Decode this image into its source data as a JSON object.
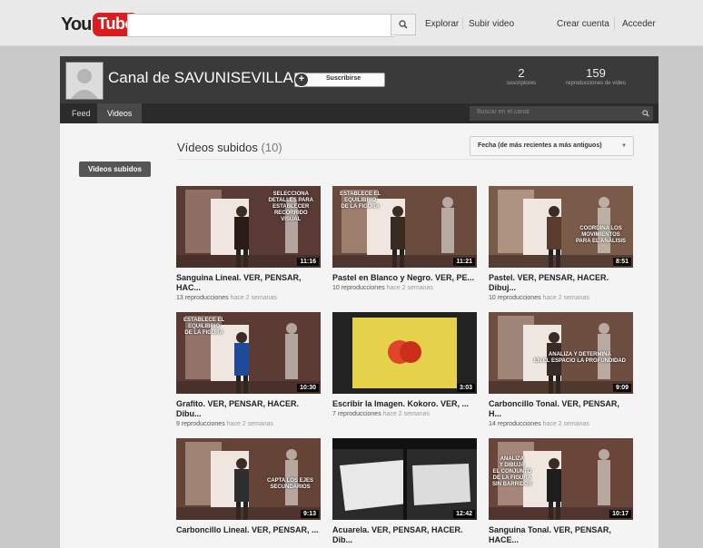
{
  "logo": {
    "you": "You",
    "tube": "Tube"
  },
  "header": {
    "search_placeholder": "",
    "explore": "Explorar",
    "upload": "Subir video",
    "create_account": "Crear cuenta",
    "sign_in": "Acceder"
  },
  "channel": {
    "title": "Canal de SAVUNISEVILLA",
    "subscribe": "Suscribirse",
    "subscribers_count": "2",
    "subscribers_label": "suscriptores",
    "views_count": "159",
    "views_label": "reproducciones de vídeo",
    "tabs": [
      "Feed",
      "Videos"
    ],
    "search_placeholder": "Buscar en el canal"
  },
  "sidebar": {
    "filter": "Videos subidos"
  },
  "section": {
    "title": "Vídeos subidos",
    "count": "(10)",
    "sort": "Fecha (de más recientes a más antiguos)"
  },
  "colors": {
    "youtube_red": "#d81e1e",
    "channel_bar": "#3a3a3a",
    "nav_bar": "#2b2b2b"
  },
  "videos": [
    {
      "title": "Sanguina Lineal. VER, PENSAR, HAC...",
      "views": "13 reproducciones",
      "ago": "hace 2 semanas",
      "duration": "11:16",
      "caption": [
        "SELECCIONA",
        "DETALLES PARA",
        "ESTABLECER",
        "RECORRIDO",
        "VISUAL"
      ]
    },
    {
      "title": "Pastel en Blanco y Negro. VER, PE...",
      "views": "10 reproducciones",
      "ago": "hace 2 semanas",
      "duration": "11:21",
      "caption": [
        "ESTABLECE EL",
        "EQUILIBRIO",
        "DE LA FIGURA"
      ]
    },
    {
      "title": "Pastel. VER, PENSAR, HACER. Dibuj...",
      "views": "10 reproducciones",
      "ago": "hace 2 semanas",
      "duration": "8:51",
      "caption": [
        "COORDINA LOS",
        "MOVIMIENTOS",
        "PARA EL ANÁLISIS"
      ]
    },
    {
      "title": "Grafito. VER, PENSAR, HACER. Dibu...",
      "views": "9 reproducciones",
      "ago": "hace 2 semanas",
      "duration": "10:30",
      "caption": [
        "ESTABLECE EL",
        "EQUILIBRIO",
        "DE LA FIGURA"
      ]
    },
    {
      "title": "Escribir la Imagen. Kokoro. VER, ...",
      "views": "7 reproducciones",
      "ago": "hace 2 semanas",
      "duration": "3:03",
      "caption": []
    },
    {
      "title": "Carboncillo Tonal. VER, PENSAR, H...",
      "views": "14 reproducciones",
      "ago": "hace 2 semanas",
      "duration": "9:09",
      "caption": [
        "ANALIZA Y DETERMINA",
        "EN EL ESPACIO LA PROFUNDIDAD"
      ]
    },
    {
      "title": "Carboncillo Lineal. VER, PENSAR, ...",
      "views": "",
      "ago": "",
      "duration": "9:13",
      "caption": [
        "CAPTA LOS EJES",
        "SECUNDARIOS"
      ]
    },
    {
      "title": "Acuarela. VER, PENSAR, HACER. Dib...",
      "views": "",
      "ago": "",
      "duration": "12:42",
      "caption": []
    },
    {
      "title": "Sanguina Tonal. VER, PENSAR, HACE...",
      "views": "",
      "ago": "",
      "duration": "10:17",
      "caption": [
        "ANALIZA",
        "Y DIBUJA",
        "EL CONJUNTO",
        "DE LA FIGURA",
        "SIN BARRIDOS"
      ]
    }
  ]
}
